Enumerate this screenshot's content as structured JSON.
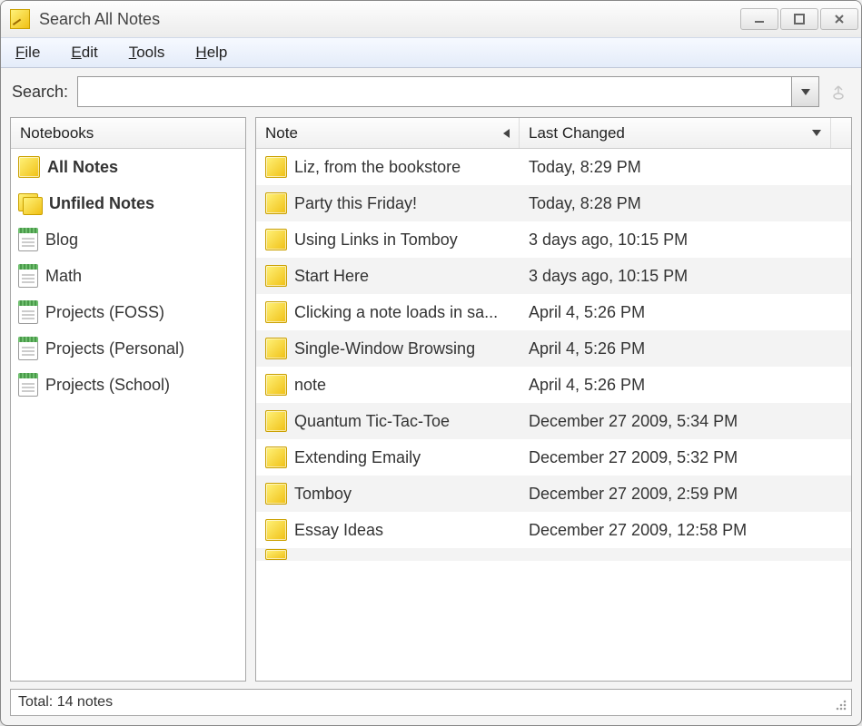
{
  "window": {
    "title": "Search All Notes"
  },
  "menubar": {
    "file": "File",
    "edit": "Edit",
    "tools": "Tools",
    "help": "Help",
    "file_u": "F",
    "edit_u": "E",
    "tools_u": "T",
    "help_u": "H"
  },
  "search": {
    "label": "Search:",
    "label_u": "S",
    "value": ""
  },
  "sidebar": {
    "header": "Notebooks",
    "items": [
      {
        "label": "All Notes",
        "icon": "note",
        "bold": true
      },
      {
        "label": "Unfiled Notes",
        "icon": "unfiled",
        "bold": true
      },
      {
        "label": "Blog",
        "icon": "notebook",
        "bold": false
      },
      {
        "label": "Math",
        "icon": "notebook",
        "bold": false
      },
      {
        "label": "Projects (FOSS)",
        "icon": "notebook",
        "bold": false
      },
      {
        "label": "Projects (Personal)",
        "icon": "notebook",
        "bold": false
      },
      {
        "label": "Projects (School)",
        "icon": "notebook",
        "bold": false
      }
    ]
  },
  "columns": {
    "note": "Note",
    "changed": "Last Changed"
  },
  "notes": [
    {
      "title": "Liz, from the bookstore",
      "changed": "Today, 8:29 PM"
    },
    {
      "title": "Party this Friday!",
      "changed": "Today, 8:28 PM"
    },
    {
      "title": "Using Links in Tomboy",
      "changed": "3 days ago, 10:15 PM"
    },
    {
      "title": "Start Here",
      "changed": "3 days ago, 10:15 PM"
    },
    {
      "title": "Clicking a note loads in sa...",
      "changed": "April 4, 5:26 PM"
    },
    {
      "title": "Single-Window Browsing",
      "changed": "April 4, 5:26 PM"
    },
    {
      "title": "note",
      "changed": "April 4, 5:26 PM"
    },
    {
      "title": "Quantum Tic-Tac-Toe",
      "changed": "December 27 2009, 5:34 PM"
    },
    {
      "title": "Extending Emaily",
      "changed": "December 27 2009, 5:32 PM"
    },
    {
      "title": "Tomboy",
      "changed": "December 27 2009, 2:59 PM"
    },
    {
      "title": "Essay Ideas",
      "changed": "December 27 2009, 12:58 PM"
    }
  ],
  "status": {
    "total": "Total: 14 notes"
  }
}
